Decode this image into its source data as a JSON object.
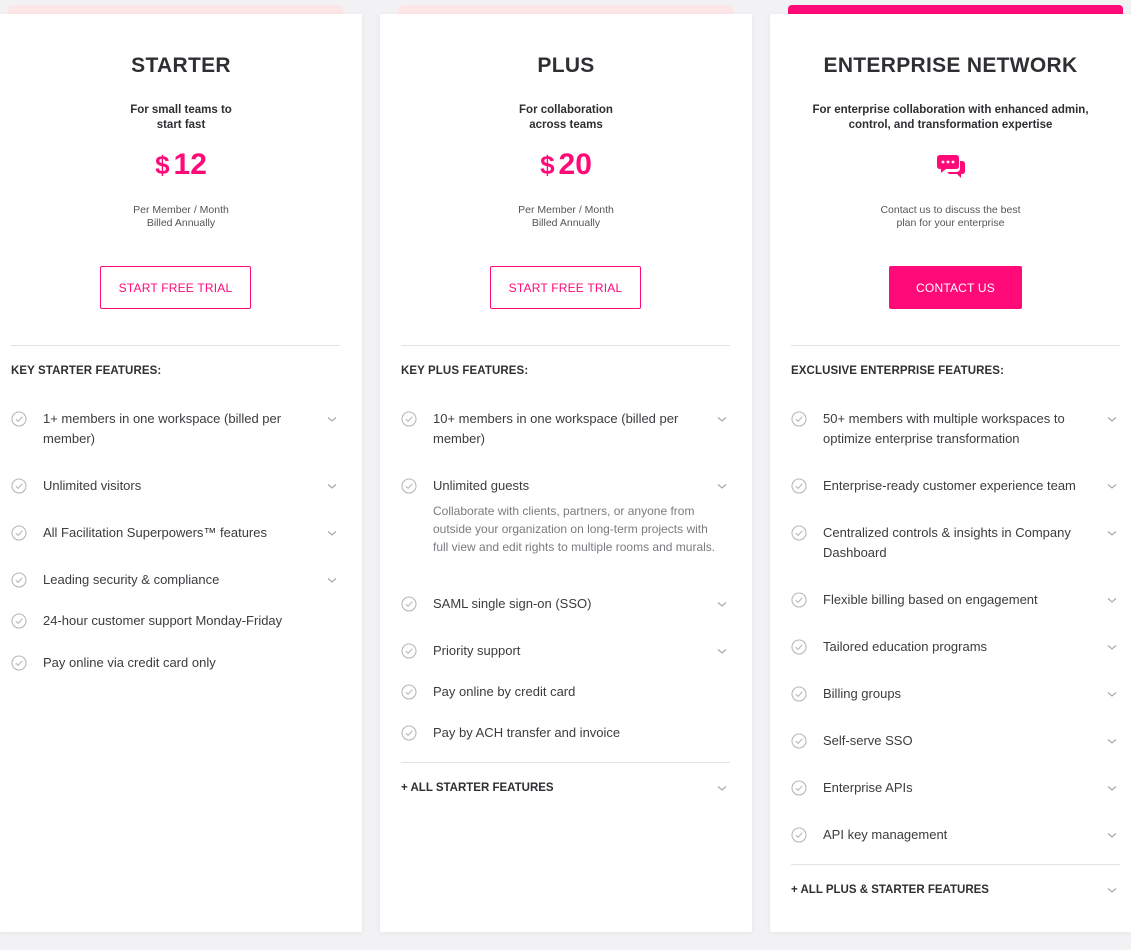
{
  "starter": {
    "title": "STARTER",
    "subtitle_line1": "For small teams to",
    "subtitle_line2": "start fast",
    "currency": "$",
    "price": "12",
    "note_line1": "Per Member / Month",
    "note_line2": "Billed Annually",
    "button": "START FREE TRIAL",
    "features_heading": "KEY STARTER FEATURES:",
    "features": [
      {
        "line1": "1+ members in one workspace (billed per",
        "line2": "member)"
      },
      {
        "line1": "Unlimited visitors"
      },
      {
        "line1": "All Facilitation Superpowers™ features"
      },
      {
        "line1": "Leading security & compliance"
      },
      {
        "line1": "24-hour customer support Monday-Friday"
      },
      {
        "line1": "Pay online via credit card only"
      }
    ]
  },
  "plus": {
    "title": "PLUS",
    "subtitle_line1": "For collaboration",
    "subtitle_line2": "across teams",
    "currency": "$",
    "price": "20",
    "note_line1": "Per Member / Month",
    "note_line2": "Billed Annually",
    "button": "START FREE TRIAL",
    "features_heading": "KEY PLUS FEATURES:",
    "features": [
      {
        "line1": "10+ members in one workspace (billed per",
        "line2": "member)"
      },
      {
        "line1": "Unlimited guests"
      },
      {
        "line1": "SAML single sign-on (SSO)"
      },
      {
        "line1": "Priority support"
      },
      {
        "line1": "Pay online by credit card"
      },
      {
        "line1": "Pay by ACH transfer and invoice"
      }
    ],
    "guests_desc_line1": "Collaborate with clients, partners, or anyone from",
    "guests_desc_line2": "outside your organization on long-term projects with",
    "guests_desc_line3": "full view and edit rights to multiple rooms and murals.",
    "all_features": "+ ALL STARTER FEATURES"
  },
  "enterprise": {
    "title": "ENTERPRISE NETWORK",
    "subtitle_line1": "For enterprise collaboration with enhanced admin,",
    "subtitle_line2": "control, and transformation expertise",
    "note_line1": "Contact us to discuss the best",
    "note_line2": "plan for your enterprise",
    "button": "CONTACT US",
    "features_heading": "EXCLUSIVE ENTERPRISE FEATURES:",
    "features": [
      {
        "line1": "50+ members with multiple workspaces to",
        "line2": "optimize enterprise transformation"
      },
      {
        "line1": "Enterprise-ready customer experience team"
      },
      {
        "line1": "Centralized controls & insights in Company",
        "line2": "Dashboard"
      },
      {
        "line1": "Flexible billing based on engagement"
      },
      {
        "line1": "Tailored education programs"
      },
      {
        "line1": "Billing groups"
      },
      {
        "line1": "Self-serve SSO"
      },
      {
        "line1": "Enterprise APIs"
      },
      {
        "line1": "API key management"
      }
    ],
    "all_features": "+ ALL PLUS & STARTER FEATURES"
  },
  "colors": {
    "accent": "#ff0a78",
    "accent_light": "#fde6e8",
    "check": "#b8b8bd"
  },
  "icons": {
    "feature_check": "check-circle-icon",
    "expand": "chevron-down-icon",
    "enterprise": "chat-bubbles-icon"
  }
}
